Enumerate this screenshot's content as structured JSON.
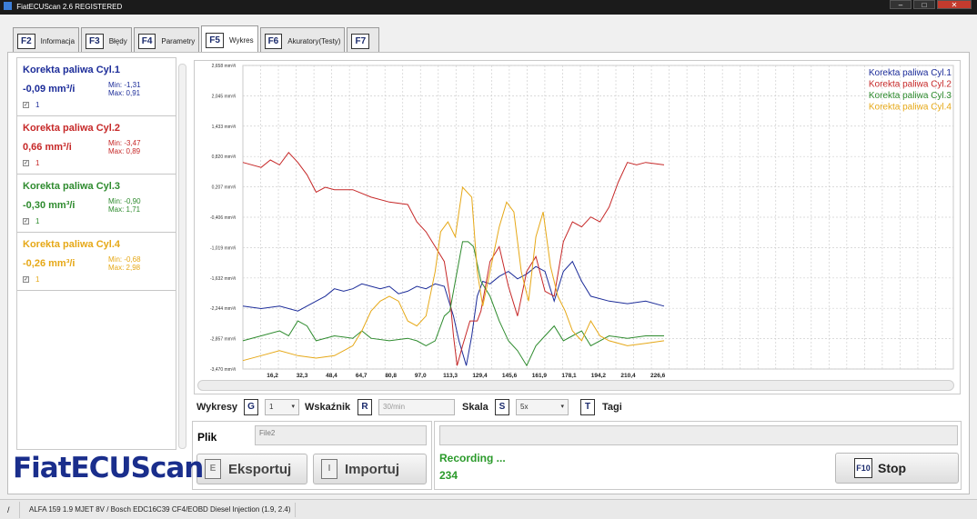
{
  "window": {
    "title": "FiatECUScan 2.6 REGISTERED",
    "minimize": "–",
    "maximize": "□",
    "close": "✕"
  },
  "tabs": [
    {
      "key": "F2",
      "label": "Informacja"
    },
    {
      "key": "F3",
      "label": "Błędy"
    },
    {
      "key": "F4",
      "label": "Parametry"
    },
    {
      "key": "F5",
      "label": "Wykres"
    },
    {
      "key": "F6",
      "label": "Akuratory(Testy)"
    },
    {
      "key": "F7",
      "label": ""
    }
  ],
  "sensors": [
    {
      "name": "Korekta paliwa Cyl.1",
      "value": "-0,09 mm³/i",
      "min": "Min: -1,31",
      "max": "Max: 0,91",
      "number": "1",
      "color": "#1c2c99"
    },
    {
      "name": "Korekta paliwa Cyl.2",
      "value": "0,66 mm³/i",
      "min": "Min: -3,47",
      "max": "Max: 0,89",
      "number": "1",
      "color": "#c62828"
    },
    {
      "name": "Korekta paliwa Cyl.3",
      "value": "-0,30 mm³/i",
      "min": "Min: -0,90",
      "max": "Max: 1,71",
      "number": "1",
      "color": "#2e8b2e"
    },
    {
      "name": "Korekta paliwa Cyl.4",
      "value": "-0,26 mm³/i",
      "min": "Min: -0,68",
      "max": "Max: 2,98",
      "number": "1",
      "color": "#e6a817"
    }
  ],
  "chart_data": {
    "type": "line",
    "y_ticks": [
      "2,658 mm³/i",
      "2,045 mm³/i",
      "1,433 mm³/i",
      "0,820 mm³/i",
      "0,207 mm³/i",
      "-0,406 mm³/i",
      "-1,019 mm³/i",
      "-1,632 mm³/i",
      "-2,244 mm³/i",
      "-2,857 mm³/i",
      "-3,470 mm³/i"
    ],
    "y_values": [
      2.658,
      2.045,
      1.433,
      0.82,
      0.207,
      -0.406,
      -1.019,
      -1.632,
      -2.244,
      -2.857,
      -3.47
    ],
    "ylim": [
      -3.47,
      2.658
    ],
    "x_ticks": [
      "16,2",
      "32,3",
      "48,4",
      "64,7",
      "80,8",
      "97,0",
      "113,3",
      "129,4",
      "145,6",
      "161,9",
      "178,1",
      "194,2",
      "210,4",
      "226,6"
    ],
    "x_values": [
      16.2,
      32.3,
      48.4,
      64.7,
      80.8,
      97.0,
      113.3,
      129.4,
      145.6,
      161.9,
      178.1,
      194.2,
      210.4,
      226.6
    ],
    "xlim": [
      0,
      388
    ],
    "legend_position": "top-right",
    "grid": true,
    "series": [
      {
        "name": "Korekta paliwa Cyl.1",
        "color": "#1c2c99",
        "x": [
          0,
          10,
          20,
          30,
          40,
          45,
          50,
          55,
          60,
          65,
          70,
          75,
          80,
          85,
          90,
          95,
          100,
          105,
          110,
          115,
          118,
          122,
          125,
          128,
          131,
          135,
          140,
          145,
          150,
          155,
          160,
          165,
          170,
          175,
          180,
          185,
          190,
          200,
          210,
          220,
          230
        ],
        "y": [
          -2.2,
          -2.25,
          -2.2,
          -2.3,
          -2.1,
          -2.0,
          -1.85,
          -1.9,
          -1.85,
          -1.75,
          -1.8,
          -1.85,
          -1.8,
          -1.95,
          -1.9,
          -1.8,
          -1.85,
          -1.75,
          -1.8,
          -2.4,
          -2.9,
          -3.4,
          -2.8,
          -2.0,
          -1.7,
          -1.75,
          -1.6,
          -1.5,
          -1.65,
          -1.55,
          -1.4,
          -1.5,
          -2.1,
          -1.5,
          -1.3,
          -1.7,
          -2.0,
          -2.1,
          -2.15,
          -2.1,
          -2.2
        ]
      },
      {
        "name": "Korekta paliwa Cyl.2",
        "color": "#c62828",
        "x": [
          0,
          10,
          15,
          20,
          25,
          30,
          35,
          40,
          45,
          50,
          60,
          70,
          80,
          90,
          95,
          100,
          105,
          110,
          113,
          115,
          117,
          120,
          124,
          128,
          130,
          135,
          140,
          145,
          150,
          155,
          160,
          165,
          170,
          175,
          180,
          185,
          190,
          195,
          200,
          205,
          210,
          215,
          220,
          230
        ],
        "y": [
          0.7,
          0.6,
          0.75,
          0.65,
          0.9,
          0.7,
          0.45,
          0.1,
          0.2,
          0.15,
          0.15,
          0.0,
          -0.1,
          -0.15,
          -0.5,
          -0.7,
          -1.0,
          -1.3,
          -2.0,
          -2.8,
          -3.4,
          -3.0,
          -2.5,
          -2.5,
          -2.3,
          -1.3,
          -1.0,
          -1.8,
          -2.4,
          -1.5,
          -1.2,
          -1.9,
          -2.0,
          -0.9,
          -0.5,
          -0.6,
          -0.4,
          -0.5,
          -0.2,
          0.3,
          0.7,
          0.65,
          0.7,
          0.65
        ]
      },
      {
        "name": "Korekta paliwa Cyl.3",
        "color": "#2e8b2e",
        "x": [
          0,
          10,
          20,
          25,
          30,
          35,
          40,
          50,
          60,
          65,
          70,
          80,
          90,
          95,
          100,
          105,
          110,
          113,
          116,
          120,
          123,
          126,
          130,
          135,
          140,
          145,
          150,
          155,
          160,
          165,
          170,
          175,
          180,
          185,
          190,
          200,
          210,
          220,
          230
        ],
        "y": [
          -2.9,
          -2.8,
          -2.7,
          -2.8,
          -2.5,
          -2.6,
          -2.9,
          -2.8,
          -2.85,
          -2.7,
          -2.85,
          -2.9,
          -2.85,
          -2.9,
          -3.0,
          -2.9,
          -2.4,
          -2.3,
          -1.7,
          -0.9,
          -0.9,
          -1.0,
          -1.7,
          -2.0,
          -2.5,
          -2.9,
          -3.1,
          -3.4,
          -3.0,
          -2.8,
          -2.6,
          -2.9,
          -2.8,
          -2.7,
          -3.0,
          -2.8,
          -2.85,
          -2.8,
          -2.8
        ]
      },
      {
        "name": "Korekta paliwa Cyl.4",
        "color": "#e6a817",
        "x": [
          0,
          10,
          20,
          30,
          40,
          50,
          60,
          65,
          70,
          75,
          80,
          85,
          90,
          95,
          100,
          105,
          108,
          112,
          116,
          120,
          125,
          128,
          131,
          135,
          140,
          144,
          148,
          152,
          156,
          160,
          164,
          168,
          172,
          176,
          180,
          185,
          190,
          195,
          200,
          210,
          220,
          230
        ],
        "y": [
          -3.3,
          -3.2,
          -3.1,
          -3.2,
          -3.25,
          -3.2,
          -3.0,
          -2.7,
          -2.3,
          -2.1,
          -2.0,
          -2.1,
          -2.5,
          -2.6,
          -2.4,
          -1.5,
          -0.7,
          -0.5,
          -0.8,
          0.2,
          0.0,
          -1.5,
          -2.2,
          -1.5,
          -0.6,
          -0.1,
          -0.3,
          -1.5,
          -2.1,
          -0.8,
          -0.3,
          -1.4,
          -2.0,
          -2.3,
          -2.7,
          -2.9,
          -2.5,
          -2.8,
          -2.9,
          -3.0,
          -2.95,
          -2.9
        ]
      }
    ]
  },
  "controls": {
    "wykresy_label": "Wykresy",
    "wykresy_key": "G",
    "wykresy_value": "1",
    "wskaznik_label": "Wskaźnik",
    "wskaznik_key": "R",
    "wskaznik_value": "30/min",
    "skala_label": "Skala",
    "skala_key": "S",
    "skala_value": "5x",
    "tagi_key": "T",
    "tagi_label": "Tagi"
  },
  "file": {
    "label": "Plik",
    "placeholder": "File2",
    "export_key": "E",
    "export_label": "Eksportuj",
    "import_key": "I",
    "import_label": "Importuj"
  },
  "recording": {
    "status": "Recording ...",
    "count": "234",
    "stop_key": "F10",
    "stop_label": "Stop"
  },
  "logo": "FiatECUScan",
  "statusbar": {
    "icon": "/",
    "text": "ALFA 159 1.9 MJET 8V / Bosch EDC16C39 CF4/EOBD Diesel Injection (1.9, 2.4)"
  }
}
